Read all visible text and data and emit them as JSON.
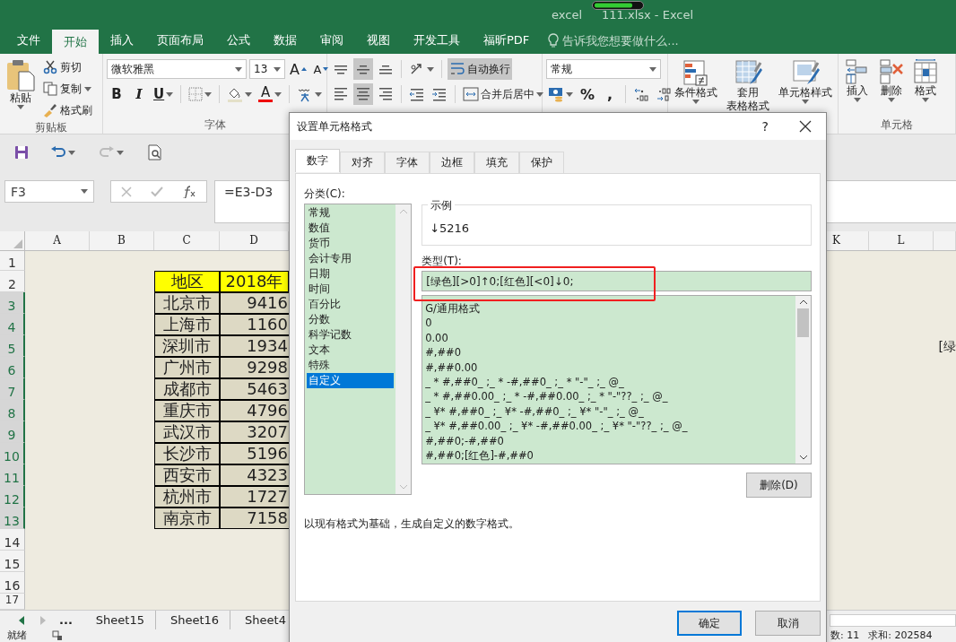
{
  "window": {
    "app": "excel",
    "title": "111.xlsx - Excel"
  },
  "ribbon_tabs": [
    {
      "label": "文件",
      "selected": false
    },
    {
      "label": "开始",
      "selected": true
    },
    {
      "label": "插入",
      "selected": false
    },
    {
      "label": "页面布局",
      "selected": false
    },
    {
      "label": "公式",
      "selected": false
    },
    {
      "label": "数据",
      "selected": false
    },
    {
      "label": "审阅",
      "selected": false
    },
    {
      "label": "视图",
      "selected": false
    },
    {
      "label": "开发工具",
      "selected": false
    },
    {
      "label": "福昕PDF",
      "selected": false
    }
  ],
  "tell_me": {
    "placeholder": "告诉我您想要做什么..."
  },
  "ribbon": {
    "clipboard": {
      "paste": "粘贴",
      "cut": "剪切",
      "copy": "复制",
      "format_painter": "格式刷",
      "label": "剪贴板"
    },
    "font": {
      "font_name": "微软雅黑",
      "font_size": "13",
      "size_buttons": [
        "A",
        "A"
      ],
      "style_buttons": [
        "B",
        "I",
        "U"
      ],
      "color_button": "A",
      "label": "字体"
    },
    "alignment": {
      "vertical_buttons": [
        {
          "selected": false
        },
        {
          "selected": true
        },
        {
          "selected": false
        }
      ],
      "horizontal_buttons": [
        {
          "selected": false
        },
        {
          "selected": true
        },
        {
          "selected": false
        }
      ],
      "wrap_text": {
        "label": "自动换行",
        "on": true
      },
      "merge": "合并后居中"
    },
    "number": {
      "format": "常规",
      "symbols": [
        "%",
        ","
      ]
    },
    "styles": [
      {
        "lines": [
          "条件格式"
        ]
      },
      {
        "lines": [
          "套用",
          "表格格式"
        ]
      },
      {
        "lines": [
          "单元格样式"
        ]
      }
    ],
    "cells": {
      "buttons": [
        "插入",
        "删除",
        "格式"
      ],
      "label": "单元格"
    }
  },
  "name_box": "F3",
  "formula": "=E3-D3",
  "columns": [
    "A",
    "B",
    "C",
    "D",
    "K",
    "L"
  ],
  "rows": [
    {
      "label": "1",
      "selected": false
    },
    {
      "label": "2",
      "selected": false
    },
    {
      "label": "3",
      "selected": true
    },
    {
      "label": "4",
      "selected": true
    },
    {
      "label": "5",
      "selected": true
    },
    {
      "label": "6",
      "selected": true
    },
    {
      "label": "7",
      "selected": true
    },
    {
      "label": "8",
      "selected": true
    },
    {
      "label": "9",
      "selected": true
    },
    {
      "label": "10",
      "selected": true
    },
    {
      "label": "11",
      "selected": true
    },
    {
      "label": "12",
      "selected": true
    },
    {
      "label": "13",
      "selected": true
    },
    {
      "label": "14",
      "selected": false
    },
    {
      "label": "15",
      "selected": false
    },
    {
      "label": "16",
      "selected": false
    },
    {
      "label": "17",
      "selected": false
    }
  ],
  "table": {
    "header": [
      "地区",
      "2018年"
    ],
    "rows": [
      [
        "北京市",
        "9416"
      ],
      [
        "上海市",
        "1160"
      ],
      [
        "深圳市",
        "1934"
      ],
      [
        "广州市",
        "9298"
      ],
      [
        "成都市",
        "5463"
      ],
      [
        "重庆市",
        "4796"
      ],
      [
        "武汉市",
        "3207"
      ],
      [
        "长沙市",
        "5196"
      ],
      [
        "西安市",
        "4323"
      ],
      [
        "杭州市",
        "1727"
      ],
      [
        "南京市",
        "7158"
      ]
    ]
  },
  "overflow_text": "[绿",
  "sheet_tabs_more": "...",
  "sheet_tabs": [
    {
      "label": "Sheet15",
      "selected": false
    },
    {
      "label": "Sheet16",
      "selected": false
    },
    {
      "label": "Sheet4",
      "selected": false
    }
  ],
  "status_bar": {
    "mode": "就绪",
    "count": "数: 11",
    "sum": "求和: 202584"
  },
  "dialog": {
    "title": "设置单元格格式",
    "help": "?",
    "tabs": [
      {
        "label": "数字",
        "selected": true
      },
      {
        "label": "对齐",
        "selected": false
      },
      {
        "label": "字体",
        "selected": false
      },
      {
        "label": "边框",
        "selected": false
      },
      {
        "label": "填充",
        "selected": false
      },
      {
        "label": "保护",
        "selected": false
      }
    ],
    "category_label": "分类(C):",
    "categories": [
      {
        "label": "常规",
        "selected": false
      },
      {
        "label": "数值",
        "selected": false
      },
      {
        "label": "货币",
        "selected": false
      },
      {
        "label": "会计专用",
        "selected": false
      },
      {
        "label": "日期",
        "selected": false
      },
      {
        "label": "时间",
        "selected": false
      },
      {
        "label": "百分比",
        "selected": false
      },
      {
        "label": "分数",
        "selected": false
      },
      {
        "label": "科学记数",
        "selected": false
      },
      {
        "label": "文本",
        "selected": false
      },
      {
        "label": "特殊",
        "selected": false
      },
      {
        "label": "自定义",
        "selected": true
      }
    ],
    "sample_label": "示例",
    "sample": "↓5216",
    "type_label": "类型(T):",
    "type_value": "[绿色][>0]↑0;[红色][<0]↓0;",
    "formats": [
      "G/通用格式",
      "0",
      "0.00",
      "#,##0",
      "#,##0.00",
      "_ * #,##0_ ;_ * -#,##0_ ;_ * \"-\"_ ;_ @_",
      "_ * #,##0.00_ ;_ * -#,##0.00_ ;_ * \"-\"??_ ;_ @_",
      "_ ¥* #,##0_ ;_ ¥* -#,##0_ ;_ ¥* \"-\"_ ;_ @_",
      "_ ¥* #,##0.00_ ;_ ¥* -#,##0.00_ ;_ ¥* \"-\"??_ ;_ @_",
      "#,##0;-#,##0",
      "#,##0;[红色]-#,##0"
    ],
    "delete_button": "删除(D)",
    "description": "以现有格式为基础，生成自定义的数字格式。",
    "ok": "确定",
    "cancel": "取消"
  }
}
